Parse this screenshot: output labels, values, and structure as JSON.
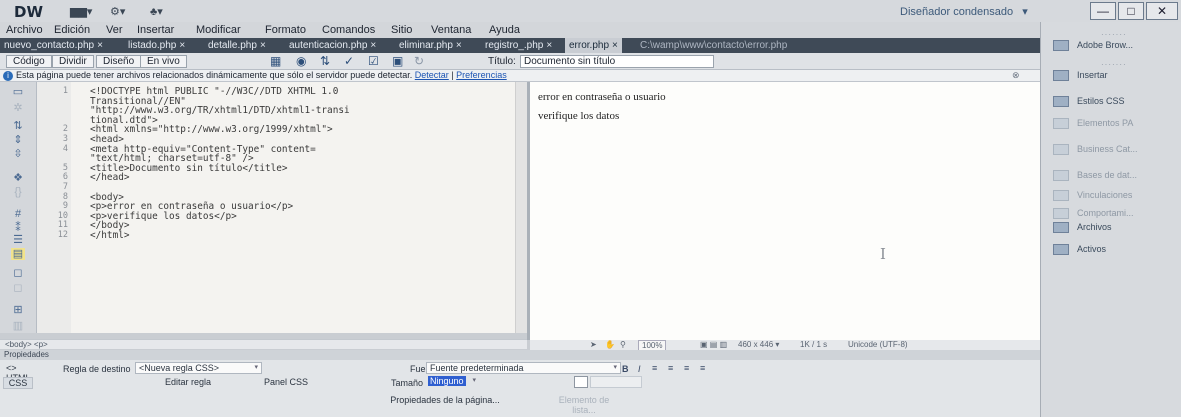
{
  "app": {
    "logo": "DW",
    "workspace": "Diseñador condensado",
    "workspace_caret": "▾"
  },
  "window_controls": {
    "minimize": "—",
    "maximize": "□",
    "close": "✕"
  },
  "menubar": [
    "Archivo",
    "Edición",
    "Ver",
    "Insertar",
    "Modificar",
    "Formato",
    "Comandos",
    "Sitio",
    "Ventana",
    "Ayuda"
  ],
  "doc_tabs": [
    {
      "label": "nuevo_contacto.php",
      "close": "×",
      "active": false
    },
    {
      "label": "listado.php",
      "close": "×",
      "active": false
    },
    {
      "label": "detalle.php",
      "close": "×",
      "active": false
    },
    {
      "label": "autenticacion.php",
      "close": "×",
      "active": false
    },
    {
      "label": "eliminar.php",
      "close": "×",
      "active": false
    },
    {
      "label": "registro_.php",
      "close": "×",
      "active": false
    },
    {
      "label": "error.php",
      "close": "×",
      "active": true
    }
  ],
  "tab_path": "C:\\wamp\\www\\contacto\\error.php",
  "doc_toolbar": {
    "views": [
      "Código",
      "Dividir",
      "Diseño",
      "En vivo"
    ],
    "title_label": "Título:",
    "title_value": "Documento sin título"
  },
  "infobar": {
    "icon": "i",
    "text": "Esta página puede tener archivos relacionados dinámicamente que sólo el servidor puede detectar.",
    "link_detect": "Detectar",
    "sep": "|",
    "link_prefs": "Preferencias",
    "close": "⊗"
  },
  "code": {
    "lines": [
      {
        "n": "1",
        "t": "<!DOCTYPE html PUBLIC \"-//W3C//DTD XHTML 1.0"
      },
      {
        "n": "",
        "t": "Transitional//EN\""
      },
      {
        "n": "",
        "t": "\"http://www.w3.org/TR/xhtml1/DTD/xhtml1-transi"
      },
      {
        "n": "",
        "t": "tional.dtd\">"
      },
      {
        "n": "2",
        "t": "<html xmlns=\"http://www.w3.org/1999/xhtml\">"
      },
      {
        "n": "3",
        "t": "<head>"
      },
      {
        "n": "4",
        "t": "<meta http-equiv=\"Content-Type\" content="
      },
      {
        "n": "",
        "t": "\"text/html; charset=utf-8\" />"
      },
      {
        "n": "5",
        "t": "<title>Documento sin título</title>"
      },
      {
        "n": "6",
        "t": "</head>"
      },
      {
        "n": "7",
        "t": ""
      },
      {
        "n": "8",
        "t": "<body>"
      },
      {
        "n": "9",
        "t": "<p>error en contraseña o usuario</p>"
      },
      {
        "n": "10",
        "t": "<p>verifique los datos</p>"
      },
      {
        "n": "11",
        "t": "</body>"
      },
      {
        "n": "12",
        "t": "</html>"
      }
    ]
  },
  "design": {
    "para1": "error en contraseña o usuario",
    "para2": "verifique los datos"
  },
  "status": {
    "tag_selector": "<body> <p>",
    "zoom": "100%",
    "dimensions": "460 x 446 ▾",
    "download": "1K / 1 s",
    "encoding": "Unicode (UTF-8)"
  },
  "properties": {
    "header": "Propiedades",
    "html_btn": "<> HTML",
    "css_btn": "CSS",
    "rule_label": "Regla de destino",
    "rule_value": "<Nueva regla CSS>",
    "edit_rule": "Editar regla",
    "css_panel": "Panel CSS",
    "font_label": "Fuente",
    "font_value": "Fuente predeterminada",
    "size_label": "Tamaño",
    "size_value": "Ninguno",
    "page_props": "Propiedades de la página...",
    "list_item": "Elemento de lista..."
  },
  "right_panel": {
    "items": [
      {
        "label": "Adobe Brow...",
        "dim": false
      },
      {
        "label": "Insertar",
        "dim": false
      },
      {
        "label": "Estilos CSS",
        "dim": false
      },
      {
        "label": "Elementos PA",
        "dim": true
      },
      {
        "label": "Business Cat...",
        "dim": true
      },
      {
        "label": "Bases de dat...",
        "dim": true
      },
      {
        "label": "Vinculaciones",
        "dim": true
      },
      {
        "label": "Comportami...",
        "dim": true
      },
      {
        "label": "Archivos",
        "dim": false
      },
      {
        "label": "Activos",
        "dim": false
      }
    ]
  },
  "colors": {
    "tabbar": "#3f4a57",
    "active_tab": "#c9cdd3",
    "link": "#1d55b3",
    "selection": "#2f5fd0"
  }
}
